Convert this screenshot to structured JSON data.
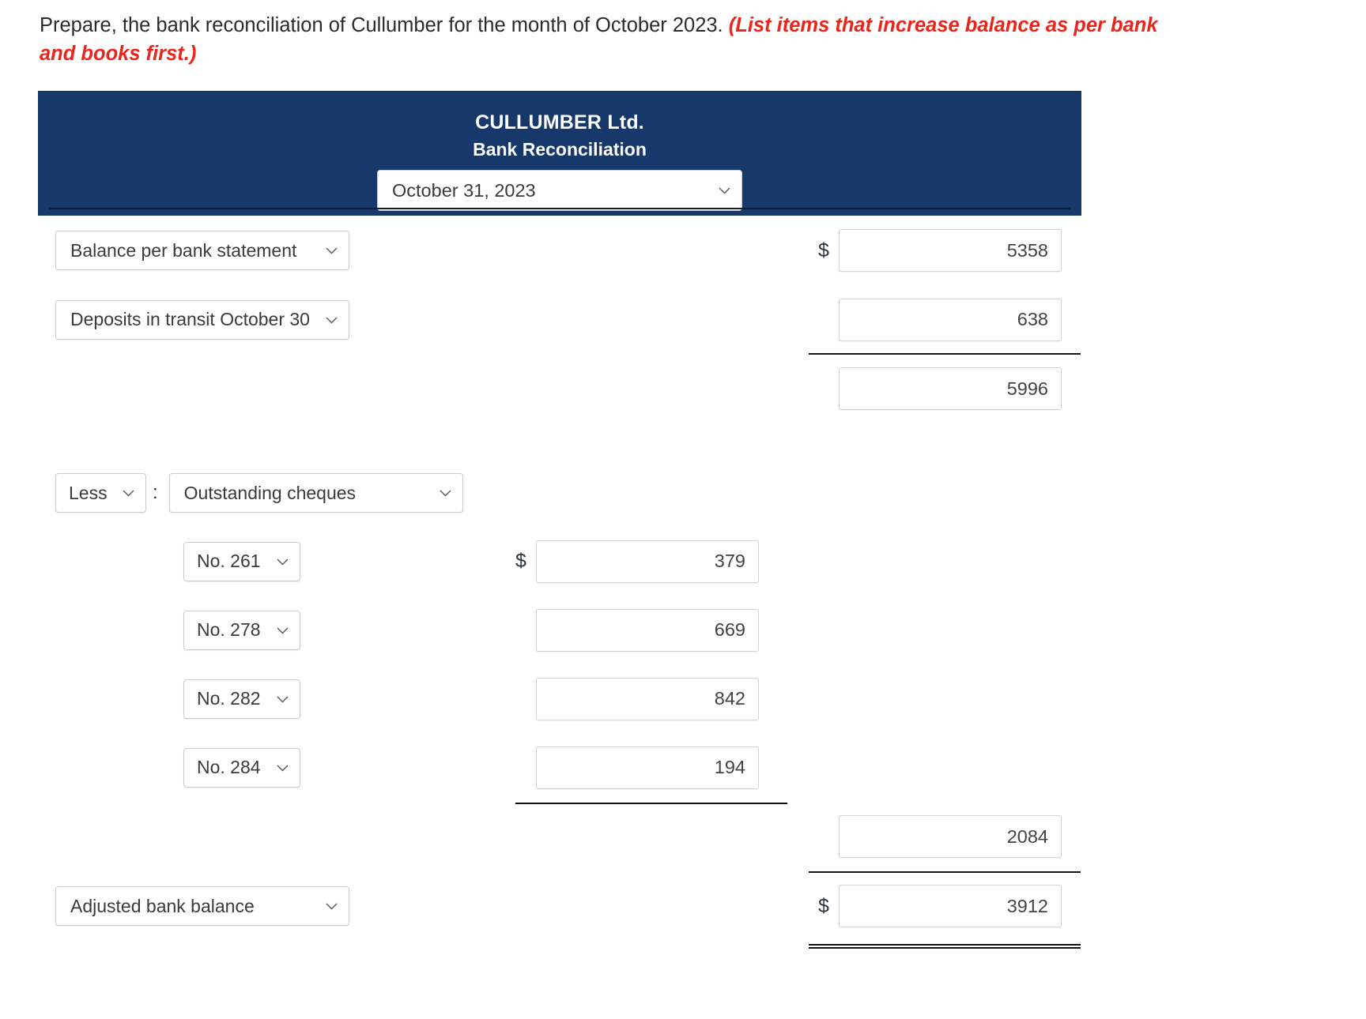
{
  "prompt": {
    "text": "Prepare, the bank reconciliation of Cullumber for the month of October 2023.",
    "hint": "(List items that increase balance as per bank and books first.)"
  },
  "statement": {
    "company": "CULLUMBER Ltd.",
    "title": "Bank Reconciliation",
    "date": "October 31, 2023",
    "colors": {
      "header_bg": "#17386b",
      "hint_red": "#e8261c"
    }
  },
  "rows": [
    {
      "label": "Balance per bank statement",
      "right_currency": "$",
      "right_value": "5358"
    },
    {
      "label": "Deposits in transit October 30",
      "right_currency": "",
      "right_value": "638"
    },
    {
      "label": "",
      "right_currency": "",
      "right_value": "5996"
    }
  ],
  "less": {
    "qualifier": "Less",
    "colon": ":",
    "description": "Outstanding cheques"
  },
  "cheques": [
    {
      "no": "No. 261",
      "currency": "$",
      "value": "379"
    },
    {
      "no": "No. 278",
      "currency": "",
      "value": "669"
    },
    {
      "no": "No. 282",
      "currency": "",
      "value": "842"
    },
    {
      "no": "No. 284",
      "currency": "",
      "value": "194"
    }
  ],
  "totals": {
    "cheques_total": "2084",
    "adjusted_label": "Adjusted bank balance",
    "adjusted_currency": "$",
    "adjusted_value": "3912"
  },
  "icons": {
    "chevron": "chevron-down-icon"
  }
}
